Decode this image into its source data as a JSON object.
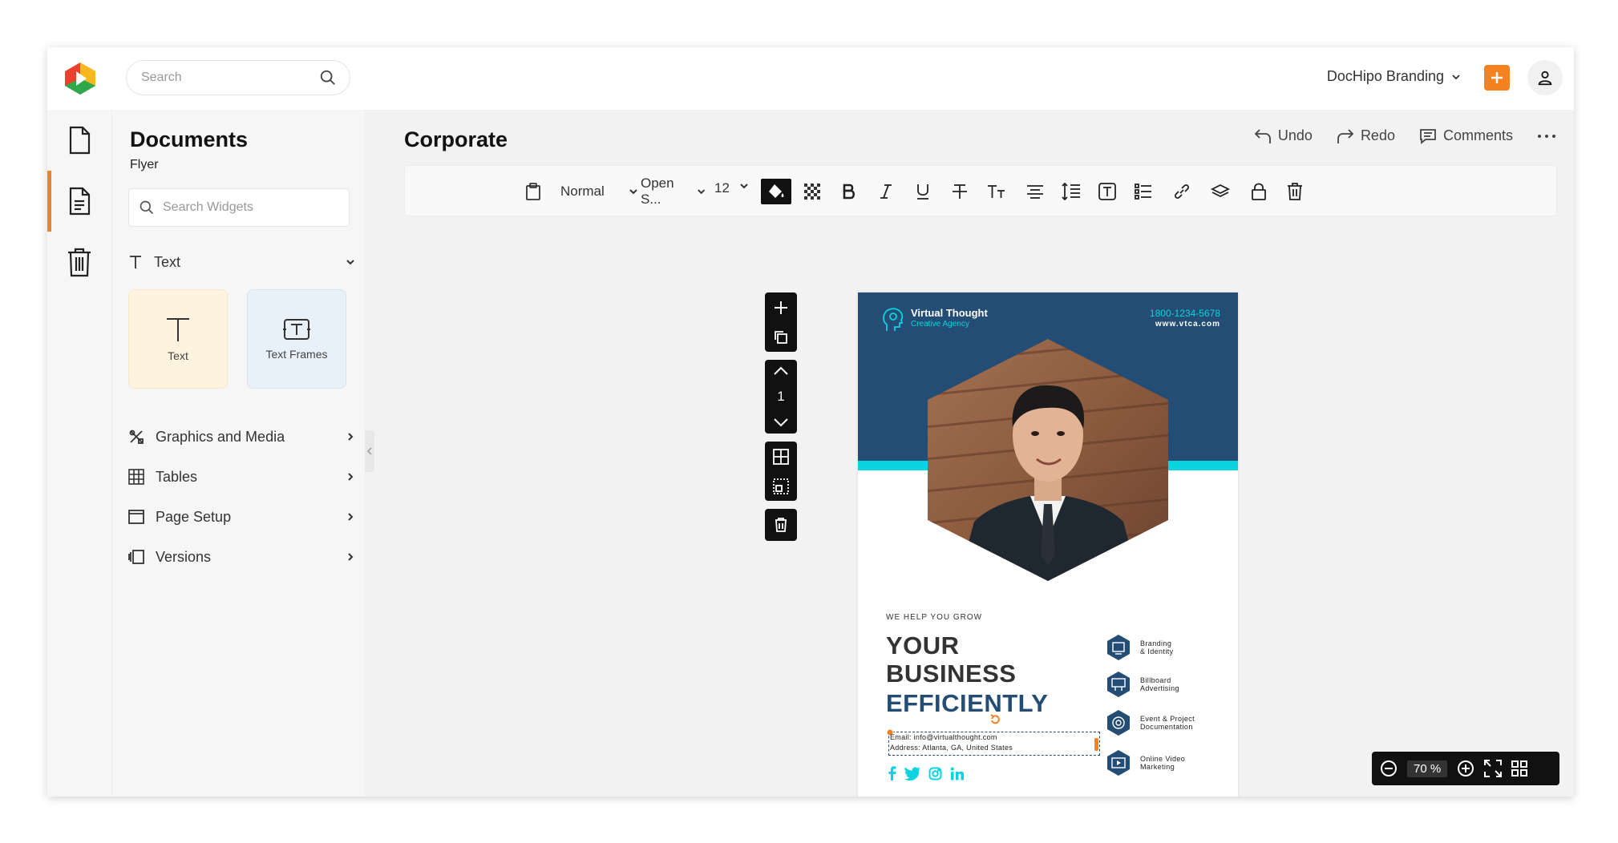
{
  "topbar": {
    "search_placeholder": "Search",
    "brand_label": "DocHipo Branding"
  },
  "sidebar": {
    "title": "Documents",
    "subtitle": "Flyer",
    "search_placeholder": "Search Widgets",
    "text_section": "Text",
    "widgets": [
      {
        "label": "Text"
      },
      {
        "label": "Text Frames"
      }
    ],
    "sections": [
      {
        "label": "Graphics and Media"
      },
      {
        "label": "Tables"
      },
      {
        "label": "Page Setup"
      },
      {
        "label": "Versions"
      }
    ]
  },
  "main": {
    "doc_title": "Corporate",
    "actions": {
      "undo": "Undo",
      "redo": "Redo",
      "comments": "Comments"
    },
    "toolbar": {
      "style": "Normal",
      "font": "Open S...",
      "size": "12"
    },
    "page_number": "1"
  },
  "flyer": {
    "brand_name": "Virtual Thought",
    "brand_tag": "Creative Agency",
    "phone": "1800-1234-5678",
    "website": "www.vtca.com",
    "kicker": "WE HELP YOU GROW",
    "headline_1": "YOUR",
    "headline_2": "BUSINESS",
    "headline_3": "EFFICIENTLY",
    "email": "Email: info@virtualthought.com",
    "address": "Address: Atlanta, GA, United States",
    "services": [
      {
        "line1": "Branding",
        "line2": "& Identity"
      },
      {
        "line1": "Billboard",
        "line2": "Advertising"
      },
      {
        "line1": "Event & Project",
        "line2": "Documentation"
      },
      {
        "line1": "Online Video",
        "line2": "Marketing"
      }
    ],
    "colors": {
      "navy": "#234d74",
      "cyan": "#0bd3df"
    }
  },
  "zoom": {
    "value": "70 %"
  },
  "accent_color": "#f58220"
}
